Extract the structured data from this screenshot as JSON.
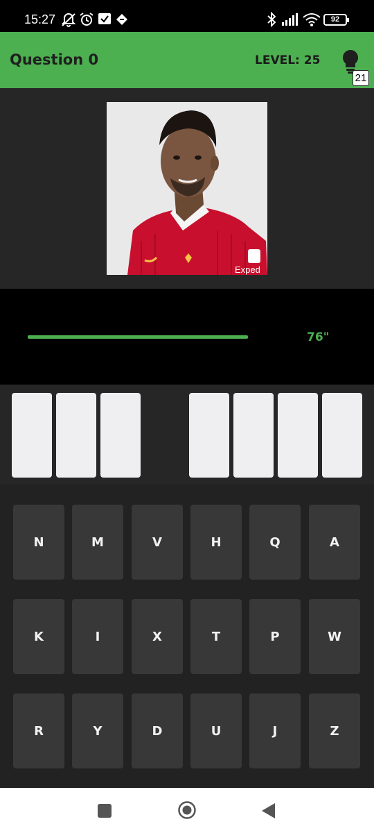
{
  "status_bar": {
    "time": "15:27",
    "battery": "92",
    "icons": [
      "muted-notifications-icon",
      "alarm-icon",
      "checkbox-notification-icon",
      "data-saver-icon",
      "bluetooth-icon",
      "signal-icon",
      "wifi-icon",
      "battery-icon"
    ]
  },
  "header": {
    "question": "Question 0",
    "level": "LEVEL: 25",
    "hints_count": "21",
    "hint_icon": "lightbulb-icon",
    "bg_color": "#4caf50"
  },
  "timer": {
    "text": "76\"",
    "progress": 0.76,
    "color": "#4caf50"
  },
  "answer": {
    "word1_slots": 3,
    "word2_slots": 4
  },
  "keyboard": {
    "rows": [
      [
        "N",
        "M",
        "V",
        "H",
        "Q",
        "A"
      ],
      [
        "K",
        "I",
        "X",
        "T",
        "P",
        "W"
      ],
      [
        "R",
        "Y",
        "D",
        "U",
        "J",
        "Z"
      ]
    ]
  },
  "nav_bar": {
    "icons": [
      "recents-square-icon",
      "home-circle-icon",
      "back-triangle-icon"
    ]
  }
}
